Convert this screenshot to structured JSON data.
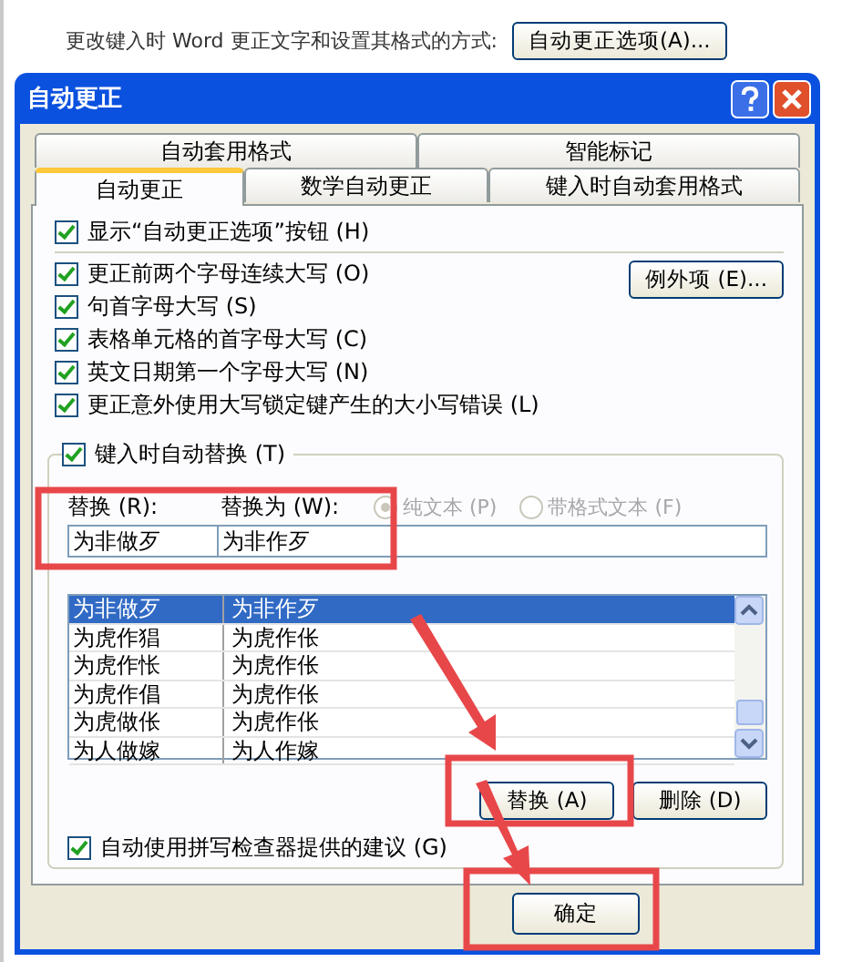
{
  "background": {
    "prompt": "更改键入时 Word 更正文字和设置其格式的方式:",
    "options_button": "自动更正选项(A)..."
  },
  "dialog": {
    "title": "自动更正",
    "tab_rows": [
      [
        {
          "label": "自动套用格式",
          "selected": false
        },
        {
          "label": "智能标记",
          "selected": false
        }
      ],
      [
        {
          "label": "自动更正",
          "selected": true
        },
        {
          "label": "数学自动更正",
          "selected": false
        },
        {
          "label": "键入时自动套用格式",
          "selected": false
        }
      ]
    ],
    "show_options": {
      "label": "显示“自动更正选项”按钮 (H)",
      "checked": true
    },
    "options": [
      {
        "label": "更正前两个字母连续大写 (O)",
        "checked": true
      },
      {
        "label": "句首字母大写 (S)",
        "checked": true
      },
      {
        "label": "表格单元格的首字母大写 (C)",
        "checked": true
      },
      {
        "label": "英文日期第一个字母大写 (N)",
        "checked": true
      },
      {
        "label": "更正意外使用大写锁定键产生的大小写错误 (L)",
        "checked": true
      }
    ],
    "exceptions_button": "例外项 (E)...",
    "replace_group": {
      "checkbox": {
        "label": "键入时自动替换 (T)",
        "checked": true
      },
      "replace_label": "替换 (R):",
      "with_label": "替换为 (W):",
      "radios": [
        {
          "label": "纯文本 (P)",
          "selected": true,
          "disabled": true
        },
        {
          "label": "带格式文本 (F)",
          "selected": false,
          "disabled": true
        }
      ],
      "replace_value": "为非做歹",
      "with_value": "为非作歹",
      "rows": [
        {
          "from": "为非做歹",
          "to": "为非作歹",
          "selected": true
        },
        {
          "from": "为虎作猖",
          "to": "为虎作伥",
          "selected": false
        },
        {
          "from": "为虎作怅",
          "to": "为虎作伥",
          "selected": false
        },
        {
          "from": "为虎作倡",
          "to": "为虎作伥",
          "selected": false
        },
        {
          "from": "为虎做伥",
          "to": "为虎作伥",
          "selected": false
        },
        {
          "from": "为人做嫁",
          "to": "为人作嫁",
          "selected": false
        }
      ],
      "buttons": [
        "替换 (A)",
        "删除 (D)"
      ],
      "spell_checkbox": {
        "label": "自动使用拼写检查器提供的建议 (G)",
        "checked": true
      }
    },
    "ok_button": "确定"
  }
}
